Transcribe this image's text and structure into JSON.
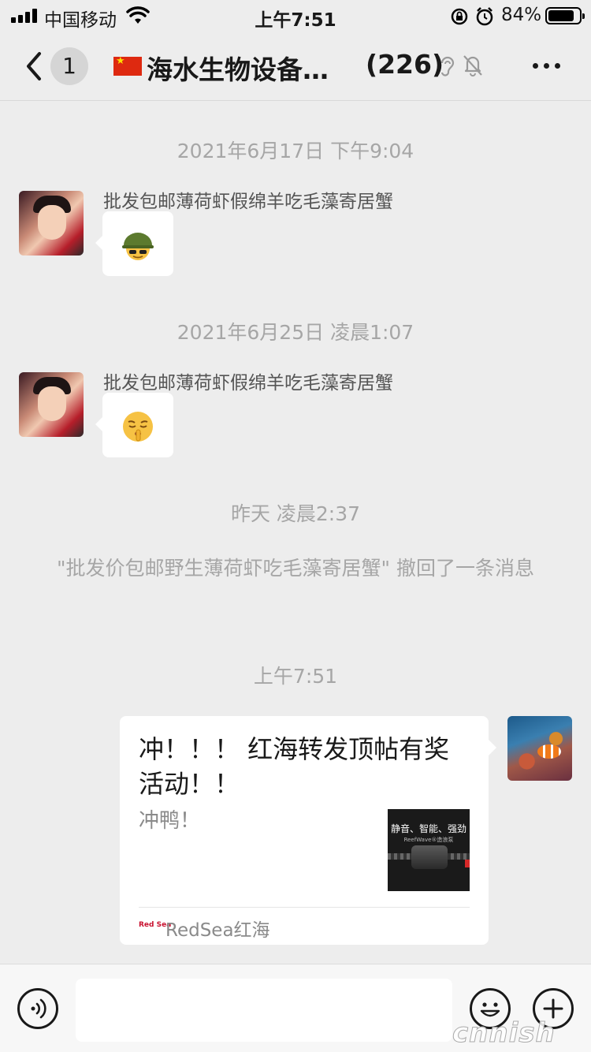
{
  "status_bar": {
    "carrier": "中国移动",
    "time": "上午7:51",
    "battery_pct": "84%",
    "battery_level": 0.84,
    "icons": [
      "signal-icon",
      "wifi-icon",
      "orientation-lock-icon",
      "alarm-icon",
      "battery-icon"
    ]
  },
  "nav": {
    "back_icon": "chevron-left-icon",
    "unread_count": "1",
    "flag_icon": "china-flag-icon",
    "title": "海水生物设备…",
    "member_count": "(226)",
    "status_icons": [
      "ear-icon",
      "bell-muted-icon"
    ],
    "more_icon": "more-dots-icon"
  },
  "messages": [
    {
      "timestamp": "2021年6月17日 下午9:04",
      "sender": "批发包邮薄荷虾假绵羊吃毛藻寄居蟹",
      "content": "🪖",
      "content_emoji": "soldier-helmet-emoji"
    },
    {
      "timestamp": "2021年6月25日 凌晨1:07",
      "sender": "批发包邮薄荷虾假绵羊吃毛藻寄居蟹",
      "content": "🤫",
      "content_emoji": "shushing-face-emoji"
    }
  ],
  "recall": {
    "timestamp": "昨天 凌晨2:37",
    "text": "\"批发价包邮野生薄荷虾吃毛藻寄居蟹\" 撤回了一条消息"
  },
  "outgoing": {
    "timestamp": "上午7:51",
    "card": {
      "title": "冲！！！ 红海转发顶帖有奖活动！！",
      "description": "冲鸭！",
      "thumb_text": "静音、智能、强劲",
      "thumb_sub": "ReefWave®造浪泵",
      "source_logo": "Red Sea",
      "source_name": "RedSea红海"
    }
  },
  "input_bar": {
    "voice_icon": "voice-icon",
    "emoji_icon": "emoji-icon",
    "plus_icon": "plus-icon",
    "placeholder": ""
  },
  "watermark": "cnnish"
}
